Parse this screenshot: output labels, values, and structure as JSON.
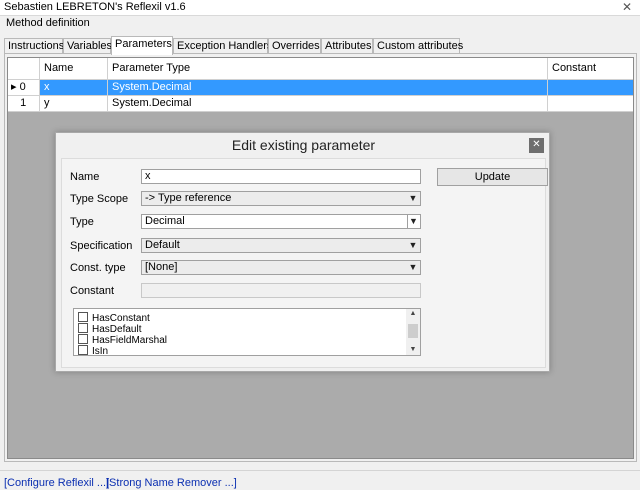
{
  "window": {
    "title": "Sebastien LEBRETON's Reflexil v1.6",
    "close_glyph": "✕"
  },
  "section_label": "Method definition",
  "tabs": [
    {
      "label": "Instructions"
    },
    {
      "label": "Variables"
    },
    {
      "label": "Parameters",
      "active": true
    },
    {
      "label": "Exception Handlers"
    },
    {
      "label": "Overrides"
    },
    {
      "label": "Attributes"
    },
    {
      "label": "Custom attributes"
    }
  ],
  "grid": {
    "columns": [
      "Name",
      "Parameter Type",
      "Constant"
    ],
    "rows": [
      {
        "index": "0",
        "marker": "▸",
        "name": "x",
        "type": "System.Decimal",
        "constant": "",
        "selected": true
      },
      {
        "index": "1",
        "marker": "",
        "name": "y",
        "type": "System.Decimal",
        "constant": ""
      }
    ]
  },
  "dialog": {
    "title": "Edit existing parameter",
    "close_glyph": "✕",
    "update_label": "Update",
    "labels": {
      "name": "Name",
      "type_scope": "Type Scope",
      "type": "Type",
      "specification": "Specification",
      "const_type": "Const. type",
      "constant": "Constant"
    },
    "values": {
      "name": "x",
      "type_scope": "-> Type reference",
      "type": "Decimal",
      "specification": "Default",
      "const_type": "[None]",
      "constant": ""
    },
    "attributes": [
      {
        "label": "HasConstant",
        "checked": false
      },
      {
        "label": "HasDefault",
        "checked": false
      },
      {
        "label": "HasFieldMarshal",
        "checked": false
      },
      {
        "label": "IsIn",
        "checked": false
      }
    ]
  },
  "footer": {
    "configure_link": "[Configure Reflexil ...]",
    "snr_link": "[Strong Name Remover ...]"
  },
  "colors": {
    "selection": "#3399ff",
    "link": "#0b2fb1",
    "grid_background": "#ababab"
  }
}
